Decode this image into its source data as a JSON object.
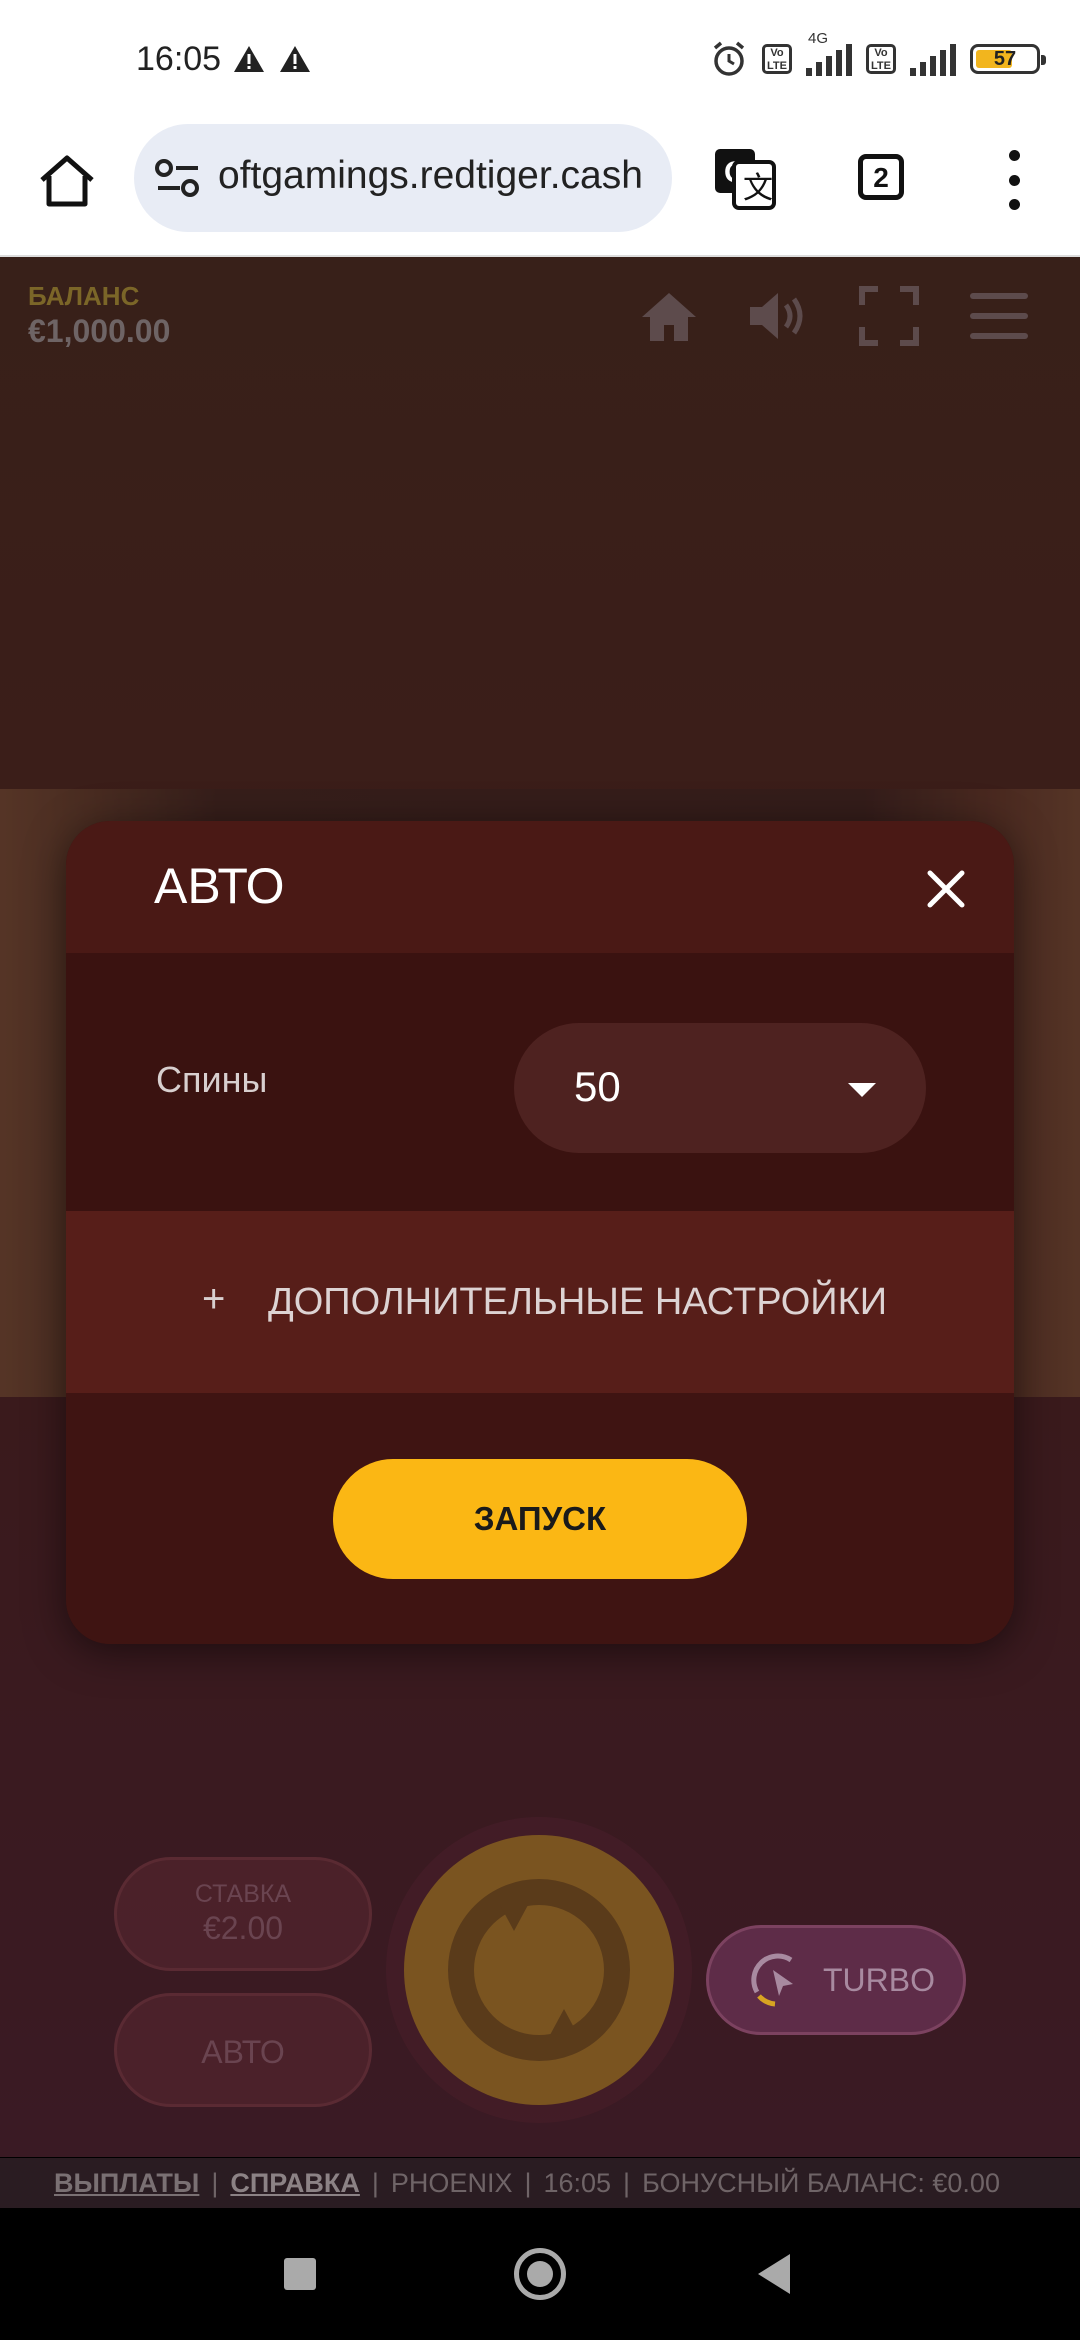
{
  "status_bar": {
    "time": "16:05",
    "network_label": "4G",
    "volte_label": "Vo\nLTE",
    "battery_level": "57",
    "icons": [
      "warning-icon",
      "warning-icon",
      "alarm-icon",
      "volte-icon",
      "signal-icon",
      "battery-icon"
    ]
  },
  "browser": {
    "url": "oftgamings.redtiger.cash",
    "tab_count": "2",
    "icons": [
      "home-icon",
      "site-settings-icon",
      "translate-icon",
      "tabs-icon",
      "more-vert-icon"
    ]
  },
  "game": {
    "balance_label": "БАЛАНС",
    "balance_value": "€1,000.00",
    "stake_label": "СТАВКА",
    "stake_value": "€2.00",
    "auto_button": "АВТО",
    "turbo_label": "TURBO",
    "colors": {
      "accent": "#fbb714",
      "panel": "#3e1412"
    }
  },
  "footer": {
    "payouts": "ВЫПЛАТЫ",
    "help": "СПРАВКА",
    "game_name": "PHOENIX",
    "time": "16:05",
    "bonus_balance": "БОНУСНЫЙ БАЛАНС: €0.00"
  },
  "modal": {
    "title": "АВТО",
    "spins_label": "Спины",
    "spins_value": "50",
    "advanced_plus": "+",
    "advanced_label": "ДОПОЛНИТЕЛЬНЫЕ НАСТРОЙКИ",
    "start_button": "ЗАПУСК"
  }
}
